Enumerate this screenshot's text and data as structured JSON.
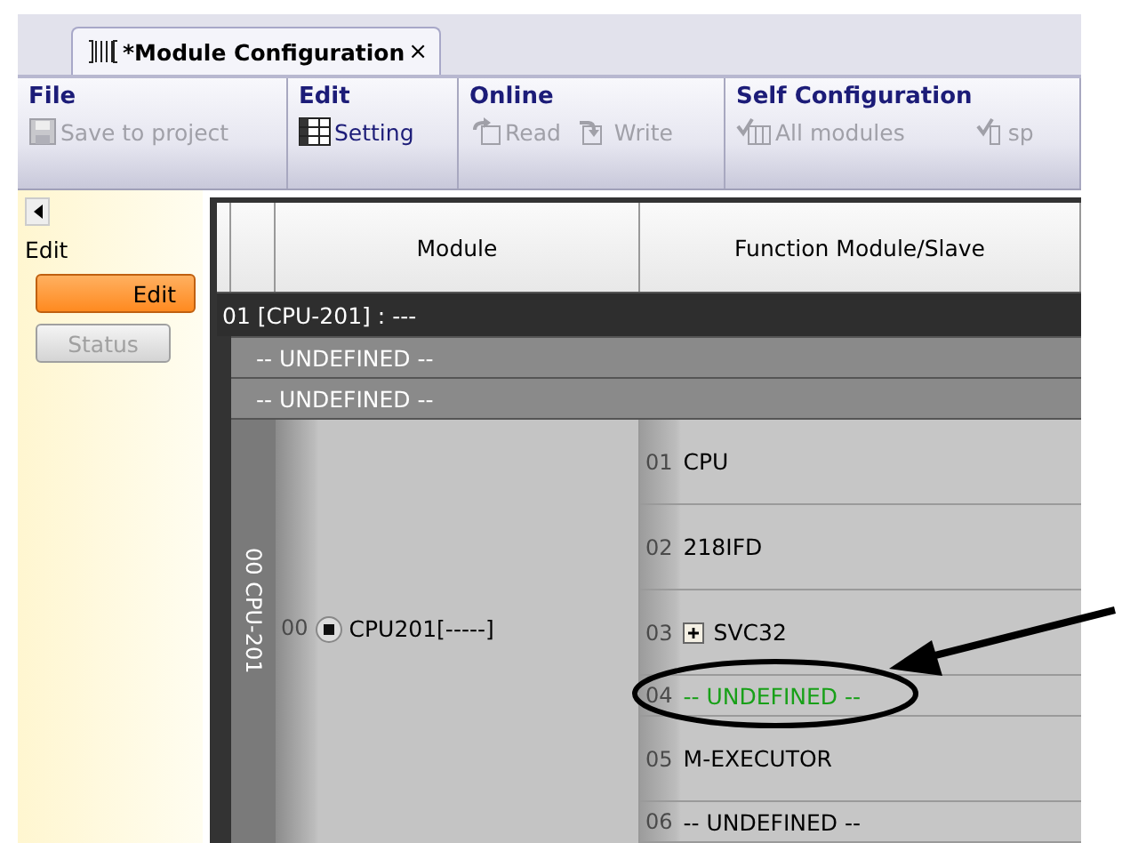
{
  "tab": {
    "title": "*Module Configuration",
    "close": "×"
  },
  "ribbon": {
    "groups": [
      {
        "title": "File",
        "items": [
          {
            "label": "Save to project",
            "disabled": true
          }
        ]
      },
      {
        "title": "Edit",
        "items": [
          {
            "label": "Setting",
            "disabled": false
          }
        ]
      },
      {
        "title": "Online",
        "items": [
          {
            "label": "Read",
            "disabled": true
          },
          {
            "label": "Write",
            "disabled": true
          }
        ]
      },
      {
        "title": "Self Configuration",
        "items": [
          {
            "label": "All modules",
            "disabled": true
          },
          {
            "label": "sp",
            "disabled": true
          }
        ]
      }
    ]
  },
  "sidebar": {
    "label": "Edit",
    "buttons": [
      {
        "label": "Edit",
        "selected": true
      },
      {
        "label": "Status",
        "selected": false
      }
    ]
  },
  "grid": {
    "columns": [
      "Module",
      "Function Module/Slave"
    ],
    "rows": [
      {
        "kind": "cpu",
        "text": "01 [CPU-201] : ---"
      },
      {
        "kind": "undefined",
        "text": "-- UNDEFINED --"
      },
      {
        "kind": "undefined",
        "text": "-- UNDEFINED --"
      }
    ],
    "slot": {
      "label": "00 CPU-201",
      "module": {
        "number": "00",
        "name": "CPU201[-----]"
      },
      "functions": [
        {
          "number": "01",
          "name": "CPU",
          "kind": "module",
          "expandable": false,
          "highlighted": false
        },
        {
          "number": "02",
          "name": "218IFD",
          "kind": "module",
          "expandable": false,
          "highlighted": false
        },
        {
          "number": "03",
          "name": "SVC32",
          "kind": "module",
          "expandable": true,
          "highlighted": false
        },
        {
          "number": "04",
          "name": "-- UNDEFINED --",
          "kind": "undefined",
          "expandable": false,
          "highlighted": true
        },
        {
          "number": "05",
          "name": "M-EXECUTOR",
          "kind": "module",
          "expandable": false,
          "highlighted": false
        },
        {
          "number": "06",
          "name": "-- UNDEFINED --",
          "kind": "undefined",
          "expandable": false,
          "highlighted": false
        }
      ]
    }
  }
}
